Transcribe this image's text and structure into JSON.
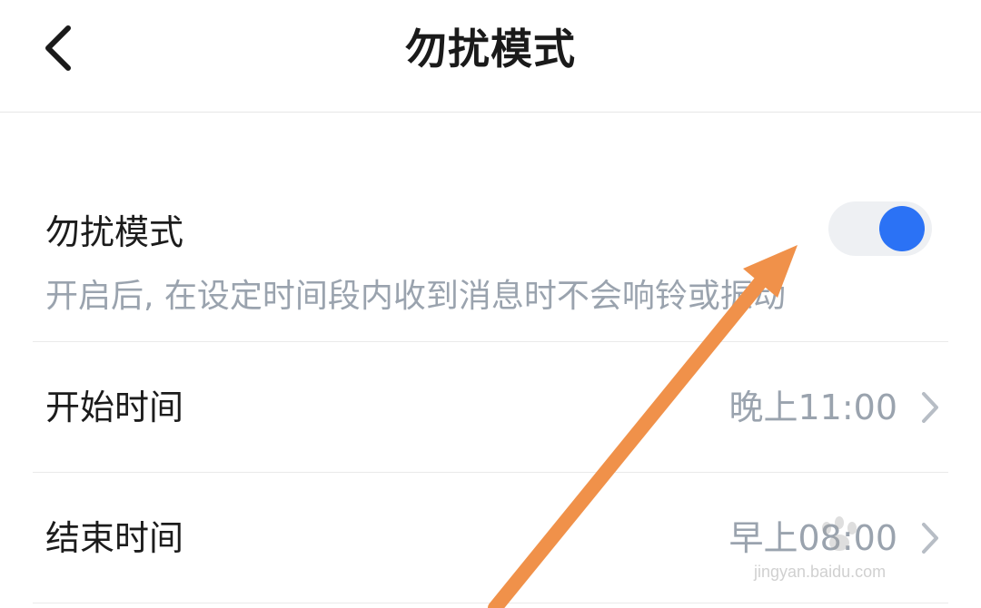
{
  "header": {
    "title": "勿扰模式",
    "back_icon": "chevron-left-icon"
  },
  "dnd": {
    "label": "勿扰模式",
    "description": "开启后, 在设定时间段内收到消息时不会响铃或振动",
    "toggle_state": "on",
    "accent_color": "#2b72f5"
  },
  "start_time": {
    "label": "开始时间",
    "value": "晚上11:00"
  },
  "end_time": {
    "label": "结束时间",
    "value": "早上08:00"
  },
  "watermark": {
    "text": "jingyan.baidu.com"
  },
  "annotation": {
    "arrow_color": "#f0914a"
  }
}
